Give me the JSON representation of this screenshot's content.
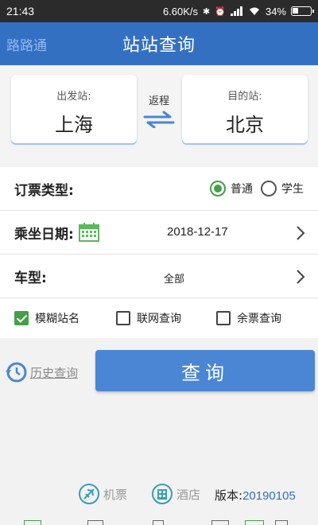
{
  "status_bar": {
    "time": "21:43",
    "network_speed": "6.60K/s",
    "battery": "34%",
    "battery_level": 0.34
  },
  "header": {
    "brand": "路路通",
    "title": "站站查询"
  },
  "stations": {
    "from_label": "出发站:",
    "from_value": "上海",
    "to_label": "目的站:",
    "to_value": "北京",
    "return_label": "返程"
  },
  "ticket_type": {
    "label": "订票类型:",
    "options": [
      "普通",
      "学生"
    ],
    "selected": "普通"
  },
  "date": {
    "label": "乘坐日期:",
    "value": "2018-12-17"
  },
  "train_type": {
    "label": "车型:",
    "value": "全部"
  },
  "filters": [
    {
      "label": "模糊站名",
      "checked": true
    },
    {
      "label": "联网查询",
      "checked": false
    },
    {
      "label": "余票查询",
      "checked": false
    }
  ],
  "actions": {
    "history": "历史查询",
    "query": "查询"
  },
  "footer": {
    "flight": "机票",
    "hotel": "酒店",
    "version_label": "版本:",
    "version_value": "20190105"
  },
  "colors": {
    "header": "#3470c2",
    "accent_green": "#43a047",
    "button": "#4a86d4"
  },
  "icons": [
    "signal-icon",
    "wifi-icon",
    "battery-icon",
    "swap-arrows-icon",
    "calendar-icon",
    "chevron-right-icon",
    "history-clock-icon",
    "plane-icon",
    "hotel-icon"
  ]
}
